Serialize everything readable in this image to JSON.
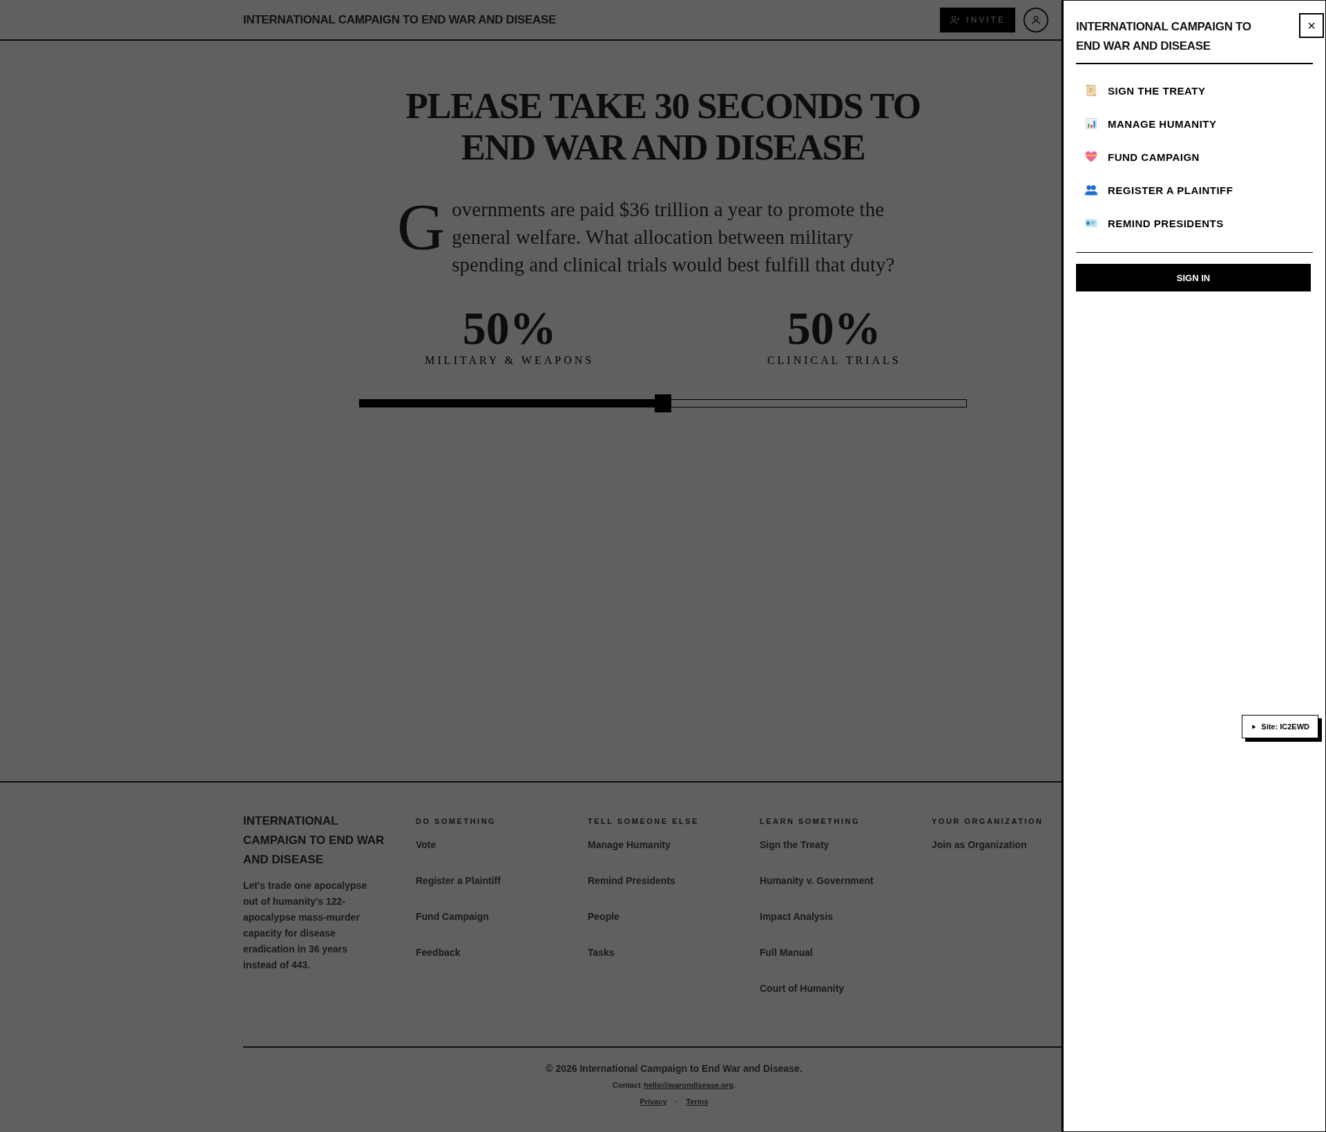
{
  "header": {
    "title": "INTERNATIONAL CAMPAIGN TO END WAR AND DISEASE",
    "invite_label": "INVITE"
  },
  "hero": {
    "heading": "PLEASE TAKE 30 SECONDS TO END WAR AND DISEASE",
    "drop_cap": "G",
    "question": "overnments are paid $36 trillion a year to promote the general welfare. What allocation between military spending and clinical trials would best fulfill that duty?"
  },
  "allocation": [
    {
      "percent": "50%",
      "label": "MILITARY & WEAPONS"
    },
    {
      "percent": "50%",
      "label": "CLINICAL TRIALS"
    }
  ],
  "slider": {
    "level": 0.5
  },
  "footer": {
    "brand": "INTERNATIONAL CAMPAIGN TO END WAR AND DISEASE",
    "description": "Let's trade one apocalypse out of humanity's 122-apocalypse mass-murder capacity for disease eradication in 36 years instead of 443.",
    "columns": [
      {
        "heading": "DO SOMETHING",
        "links": [
          "Vote",
          "Register a Plaintiff",
          "Fund Campaign",
          "Feedback"
        ]
      },
      {
        "heading": "TELL SOMEONE ELSE",
        "links": [
          "Manage Humanity",
          "Remind Presidents",
          "People",
          "Tasks"
        ]
      },
      {
        "heading": "LEARN SOMETHING",
        "links": [
          "Sign the Treaty",
          "Humanity v. Government",
          "Impact Analysis",
          "Full Manual",
          "Court of Humanity"
        ]
      },
      {
        "heading": "YOUR ORGANIZATION",
        "links": [
          "Join as Organization"
        ]
      }
    ],
    "copyright": "© 2026 International Campaign to End War and Disease.",
    "contact_label": "Contact",
    "contact_email": "hello@warondisease.org",
    "contact_end": ".",
    "links": [
      "Privacy",
      "Terms"
    ],
    "separator": "·"
  },
  "drawer": {
    "title": "INTERNATIONAL CAMPAIGN TO END WAR AND DISEASE",
    "close": "×",
    "items": [
      {
        "label": "SIGN THE TREATY",
        "kind": "scroll"
      },
      {
        "label": "MANAGE HUMANITY",
        "kind": "chart"
      },
      {
        "label": "FUND CAMPAIGN",
        "kind": "heart"
      },
      {
        "label": "REGISTER A PLAINTIFF",
        "kind": "people"
      },
      {
        "label": "REMIND PRESIDENTS",
        "kind": "card"
      }
    ],
    "sign_in": "SIGN IN"
  },
  "site_badge": {
    "label": "Site: IC2EWD"
  }
}
